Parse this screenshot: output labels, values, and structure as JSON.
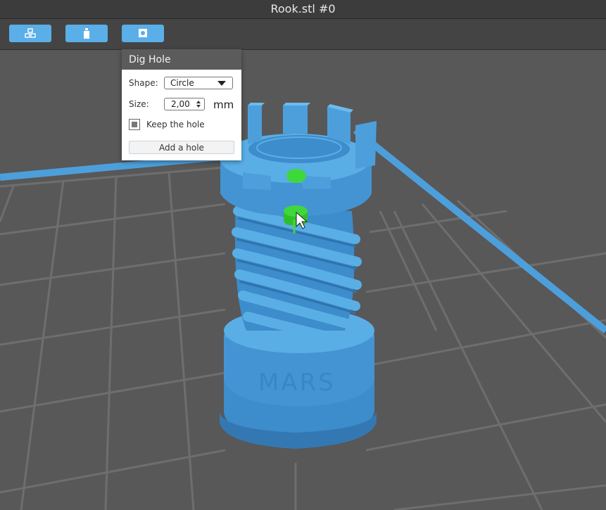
{
  "window": {
    "title": "Rook.stl #0"
  },
  "toolbar": {
    "buttons": [
      {
        "icon": "cubes-icon"
      },
      {
        "icon": "bottle-icon"
      },
      {
        "icon": "square-hole-icon"
      }
    ],
    "accent_color": "#5aafe8"
  },
  "dig_hole_panel": {
    "title": "Dig Hole",
    "shape_label": "Shape:",
    "shape_value": "Circle",
    "size_label": "Size:",
    "size_value": "2,00",
    "size_unit": "mm",
    "keep_hole_label": "Keep the hole",
    "add_button_label": "Add a hole"
  },
  "scene": {
    "model_text": "MARS",
    "model_color": "#4d9fdb",
    "marker_color": "#3ed83a",
    "platform_color": "#585858",
    "grid_color": "#6e6e6e"
  }
}
